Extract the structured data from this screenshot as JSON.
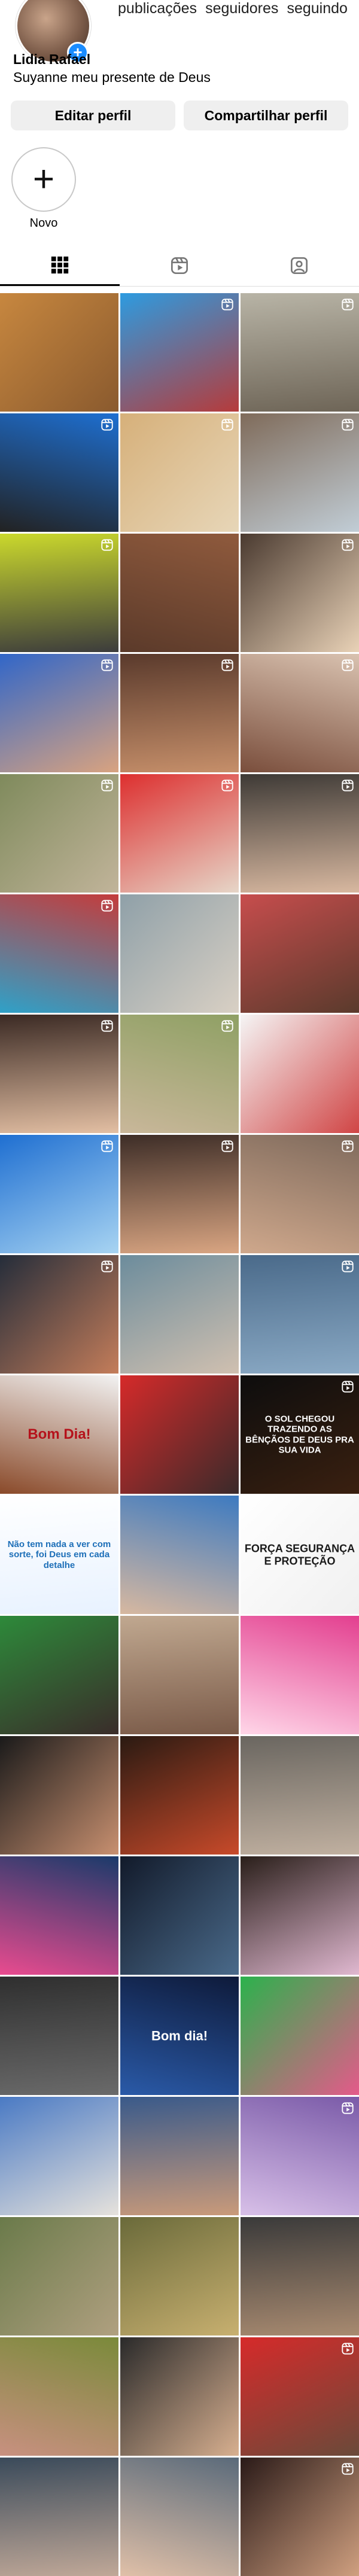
{
  "profile": {
    "name": "Lidia Rafael",
    "bio": "Suyanne meu presente de Deus",
    "stats": [
      {
        "label": "publicações"
      },
      {
        "label": "seguidores"
      },
      {
        "label": "seguindo"
      }
    ]
  },
  "buttons": {
    "edit": "Editar perfil",
    "share": "Compartilhar perfil"
  },
  "highlight": {
    "label": "Novo"
  },
  "grid": [
    {
      "c1": "#c7873f",
      "c2": "#8a5a2e",
      "reel": false
    },
    {
      "c1": "#2d9be0",
      "c2": "#b63b3b",
      "reel": true
    },
    {
      "c1": "#b8b4a6",
      "c2": "#6e6557",
      "reel": true
    },
    {
      "c1": "#1e6fd1",
      "c2": "#222222",
      "reel": true
    },
    {
      "c1": "#d6b07a",
      "c2": "#e7d6b8",
      "reel": true
    },
    {
      "c1": "#7f6b5a",
      "c2": "#c1cdd6",
      "reel": true
    },
    {
      "c1": "#cbd92c",
      "c2": "#3c3c3c",
      "reel": true
    },
    {
      "c1": "#8f5a3d",
      "c2": "#5b3a2a",
      "reel": false
    },
    {
      "c1": "#4a3a30",
      "c2": "#e9d2b7",
      "reel": true
    },
    {
      "c1": "#3166c8",
      "c2": "#d9a380",
      "reel": true
    },
    {
      "c1": "#5a3a2c",
      "c2": "#c68f6a",
      "reel": true
    },
    {
      "c1": "#d9c2b0",
      "c2": "#7a4e3c",
      "reel": true
    },
    {
      "c1": "#7f8a5c",
      "c2": "#c1b49a",
      "reel": true
    },
    {
      "c1": "#dd2f2f",
      "c2": "#e6d6c8",
      "reel": true
    },
    {
      "c1": "#3e3a36",
      "c2": "#d8b8a0",
      "reel": true
    },
    {
      "c1": "#c43c3c",
      "c2": "#2fa1c8",
      "reel": true
    },
    {
      "c1": "#8fa0a8",
      "c2": "#d9d0c4",
      "reel": false
    },
    {
      "c1": "#c74d4d",
      "c2": "#5a3a2c",
      "reel": false
    },
    {
      "c1": "#3b2a24",
      "c2": "#e3bfa3",
      "reel": true
    },
    {
      "c1": "#8fa064",
      "c2": "#c9b79a",
      "reel": true
    },
    {
      "c1": "#f5f5f5",
      "c2": "#d04545",
      "reel": false
    },
    {
      "c1": "#1f6fd1",
      "c2": "#a8d4f2",
      "reel": true
    },
    {
      "c1": "#3d2d27",
      "c2": "#d9a582",
      "reel": true
    },
    {
      "c1": "#7f6a5c",
      "c2": "#cfa88c",
      "reel": true
    },
    {
      "c1": "#252d3a",
      "c2": "#c47d5a",
      "reel": true
    },
    {
      "c1": "#6c8c9c",
      "c2": "#d0c0b0",
      "reel": false
    },
    {
      "c1": "#4a6a8a",
      "c2": "#8aa9c4",
      "reel": true
    },
    {
      "c1": "#f2f2f2",
      "c2": "#8a4a2a",
      "reel": false,
      "text": "Bom Dia!",
      "tc": "#b5121b",
      "ts": 24
    },
    {
      "c1": "#d62a2a",
      "c2": "#3a2a2a",
      "reel": false
    },
    {
      "c1": "#0d0d0d",
      "c2": "#3a2010",
      "reel": true,
      "text": "O SOL CHEGOU TRAZENDO AS BÊNÇÃOS DE DEUS PRA SUA VIDA",
      "tc": "#ffffff",
      "ts": 15
    },
    {
      "c1": "#ffffff",
      "c2": "#e8f2ff",
      "reel": false,
      "text": "Não tem nada a ver com sorte, foi Deus em cada detalhe",
      "tc": "#1d6fb8",
      "ts": 15
    },
    {
      "c1": "#3d7ac0",
      "c2": "#d7b8a0",
      "reel": false
    },
    {
      "c1": "#ffffff",
      "c2": "#f0f0f0",
      "reel": false,
      "text": "FORÇA SEGURANÇA E PROTEÇÃO",
      "tc": "#1a1a1a",
      "ts": 18
    },
    {
      "c1": "#2d8a3a",
      "c2": "#3a2c2a",
      "reel": false
    },
    {
      "c1": "#c0a890",
      "c2": "#7a5a48",
      "reel": false
    },
    {
      "c1": "#e33f8f",
      "c2": "#ffd6e8",
      "reel": false
    },
    {
      "c1": "#1a1a1a",
      "c2": "#c89070",
      "reel": false
    },
    {
      "c1": "#2a1a12",
      "c2": "#c84a2a",
      "reel": false
    },
    {
      "c1": "#6a6660",
      "c2": "#c0b0a0",
      "reel": false
    },
    {
      "c1": "#1a3a6a",
      "c2": "#e94b8f",
      "reel": false
    },
    {
      "c1": "#121a2a",
      "c2": "#4a6a8a",
      "reel": false
    },
    {
      "c1": "#2a1f1a",
      "c2": "#e0b8d0",
      "reel": false
    },
    {
      "c1": "#2f2f2f",
      "c2": "#6a6a6a",
      "reel": false
    },
    {
      "c1": "#0e1a3a",
      "c2": "#2a5aa8",
      "reel": false,
      "text": "Bom dia!",
      "tc": "#ffffff",
      "ts": 22
    },
    {
      "c1": "#2bb24c",
      "c2": "#e45a8a",
      "reel": false
    },
    {
      "c1": "#4a7ac4",
      "c2": "#e6e2dc",
      "reel": false
    },
    {
      "c1": "#3a5a8a",
      "c2": "#c99a7a",
      "reel": false
    },
    {
      "c1": "#7a5aa8",
      "c2": "#d8c0e8",
      "reel": true
    },
    {
      "c1": "#6a7a4a",
      "c2": "#b0a080",
      "reel": false
    },
    {
      "c1": "#6a6a3a",
      "c2": "#c8b070",
      "reel": false
    },
    {
      "c1": "#3a3a3a",
      "c2": "#a88a70",
      "reel": false
    },
    {
      "c1": "#7a8a3a",
      "c2": "#c89080",
      "reel": false
    },
    {
      "c1": "#2a2a2a",
      "c2": "#d8b090",
      "reel": false
    },
    {
      "c1": "#d62a2a",
      "c2": "#6a4a3a",
      "reel": true
    },
    {
      "c1": "#3a4a5a",
      "c2": "#c0a898",
      "reel": false
    },
    {
      "c1": "#5a6a7a",
      "c2": "#e0c0a8",
      "reel": false
    },
    {
      "c1": "#2a1a18",
      "c2": "#d0a080",
      "reel": true
    }
  ]
}
